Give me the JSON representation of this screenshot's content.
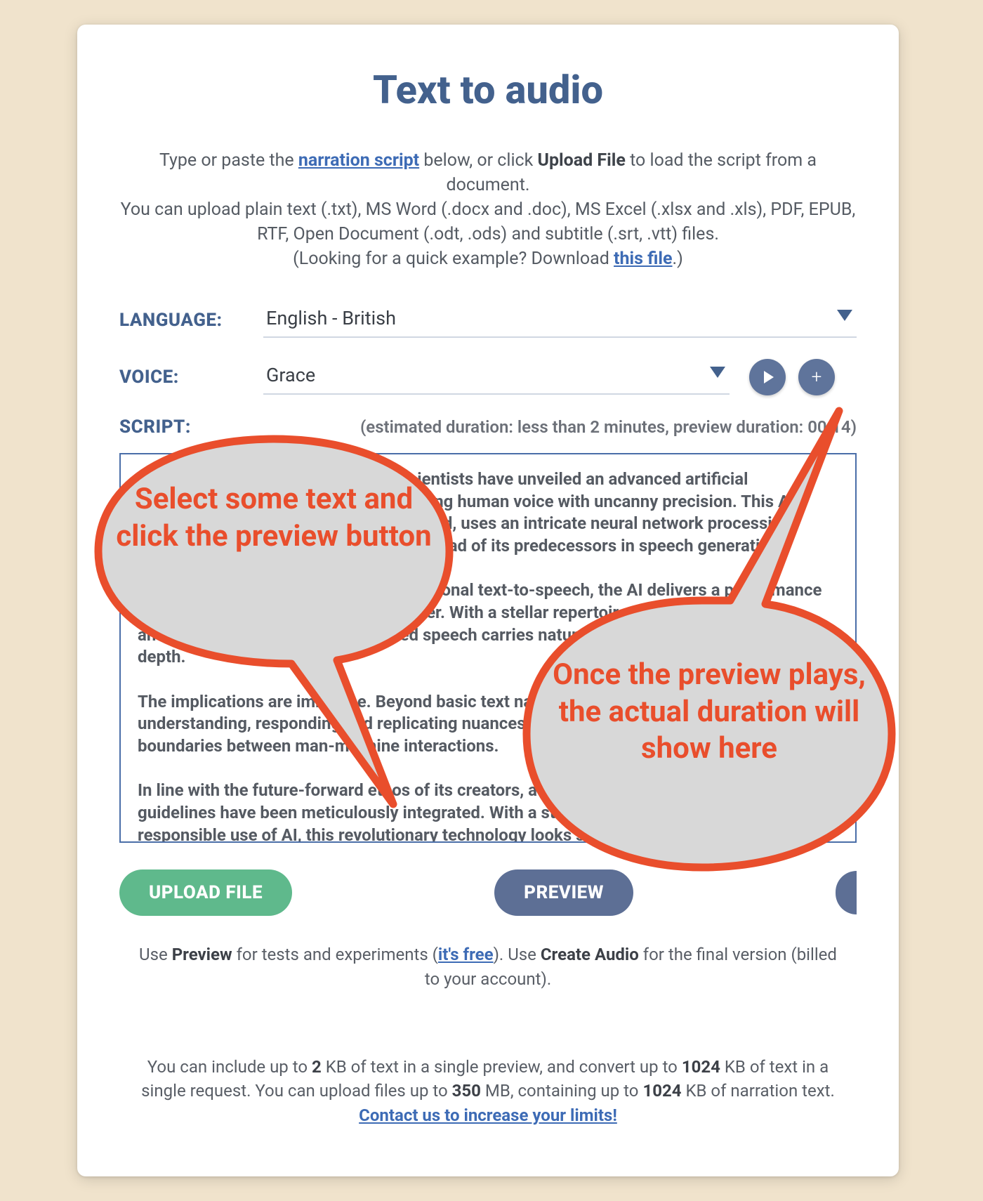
{
  "title": "Text to audio",
  "intro": {
    "line1a": "Type or paste the ",
    "line1_link": "narration script",
    "line1b": " below, or click ",
    "line1_bold": "Upload File",
    "line1c": " to load the script from a document.",
    "line2": "You can upload plain text (.txt), MS Word (.docx and .doc), MS Excel (.xlsx and .xls), PDF, EPUB, RTF, Open Document (.odt, .ods) and subtitle (.srt, .vtt) files.",
    "line3a": "(Looking for a quick example? Download ",
    "line3_link": "this file",
    "line3b": ".)"
  },
  "fields": {
    "language_label": "LANGUAGE:",
    "language_value": "English - British",
    "voice_label": "VOICE:",
    "voice_value": "Grace",
    "script_label": "SCRIPT:"
  },
  "duration_note": "(estimated duration: less than 2 minutes, preview duration: 00:14)",
  "script_text": "In a groundbreaking development, scientists have unveiled an advanced artificial intelligence system capable of replicating human voice with uncanny precision. This AI voice generator, yet to be officially named, uses an intricate neural network processing technology that propels it light-years ahead of its predecessors in speech generation.\n\nUnlike the mechanical cadence of traditional text-to-speech, the AI delivers a performance indistinguishable from a human speaker. With a stellar repertoire of accents, intonations, and voice integrations, the generated speech carries naturalistic rhythm and emotional depth.\n\nThe implications are immense. Beyond basic text narration, the system is capable of understanding, responding and replicating nuances of human conversation, blurring the boundaries between man-machine interactions.\n\nIn line with the future-forward ethos of its creators, a suite of safeguards and ethical guidelines have been meticulously integrated. With a strong focus on privacy and the responsible use of AI, this revolutionary technology looks set to usher in a new era of communication, lending a 'voice' to the future.",
  "buttons": {
    "upload": "UPLOAD FILE",
    "preview": "PREVIEW"
  },
  "hint": {
    "a": "Use ",
    "b1": "Preview",
    "b": " for tests and experiments (",
    "link": "it's free",
    "c": "). Use ",
    "b2": "Create Audio",
    "d": " for the final version (billed to your account)."
  },
  "limits": {
    "t1": "You can include up to ",
    "v1": "2",
    "t2": " KB of text in a single preview, and convert up to ",
    "v2": "1024",
    "t3": " KB of text in a single request. You can upload files up to ",
    "v3": "350",
    "t4": " MB, containing up to ",
    "v4": "1024",
    "t5": " KB of narration text.",
    "link": "Contact us to increase your limits!"
  },
  "callouts": {
    "left": "Select some text and click the preview button",
    "right": "Once the preview plays, the actual duration will show here"
  }
}
